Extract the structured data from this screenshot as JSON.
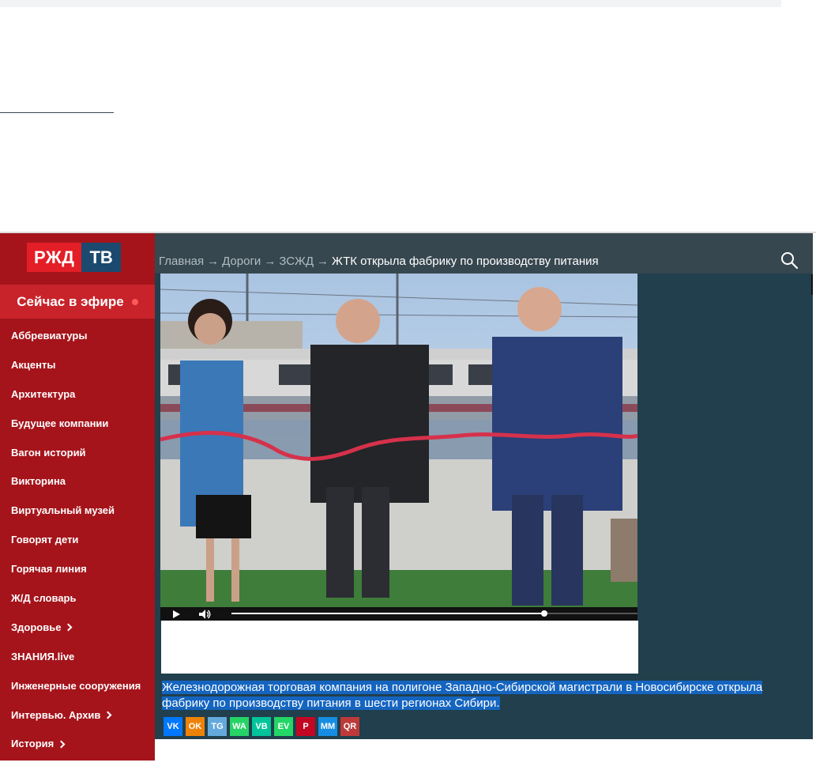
{
  "brand": {
    "logo_left": "РЖД",
    "logo_right": "ТВ"
  },
  "live_button": {
    "label": "Сейчас в эфире"
  },
  "sidebar": {
    "items": [
      {
        "label": "Аббревиатуры",
        "has_submenu": false
      },
      {
        "label": "Акценты",
        "has_submenu": false
      },
      {
        "label": "Архитектура",
        "has_submenu": false
      },
      {
        "label": "Будущее компании",
        "has_submenu": false
      },
      {
        "label": "Вагон историй",
        "has_submenu": false
      },
      {
        "label": "Викторина",
        "has_submenu": false
      },
      {
        "label": "Виртуальный музей",
        "has_submenu": false
      },
      {
        "label": "Говорят дети",
        "has_submenu": false
      },
      {
        "label": "Горячая линия",
        "has_submenu": false
      },
      {
        "label": "Ж/Д словарь",
        "has_submenu": false
      },
      {
        "label": "Здоровье",
        "has_submenu": true
      },
      {
        "label": "ЗНАНИЯ.live",
        "has_submenu": false
      },
      {
        "label": "Инженерные сооружения",
        "has_submenu": false
      },
      {
        "label": "Интервью. Архив",
        "has_submenu": true
      },
      {
        "label": "История",
        "has_submenu": true
      }
    ]
  },
  "breadcrumb": {
    "items": [
      "Главная",
      "Дороги",
      "ЗСЖД"
    ],
    "separator": "→",
    "current": "ЖТК открыла фабрику по производству питания"
  },
  "video": {
    "progress": 0.77
  },
  "article": {
    "lead": "Железнодорожная торговая компания на полигоне Западно-Сибирской магистрали в Новосибирске открыла фабрику по производству питания в шести регионах Сибири."
  },
  "share": [
    {
      "name": "vk",
      "label": "VK",
      "color": "#0077ff"
    },
    {
      "name": "odnoklassniki",
      "label": "OK",
      "color": "#ee8208"
    },
    {
      "name": "telegram",
      "label": "TG",
      "color": "#64a9dc"
    },
    {
      "name": "whatsapp",
      "label": "WA",
      "color": "#25d366"
    },
    {
      "name": "viber",
      "label": "VB",
      "color": "#00c49a"
    },
    {
      "name": "evernote",
      "label": "EV",
      "color": "#24d666"
    },
    {
      "name": "pinterest",
      "label": "P",
      "color": "#c20724"
    },
    {
      "name": "moimir",
      "label": "MM",
      "color": "#168de2"
    },
    {
      "name": "qrcode",
      "label": "QR",
      "color": "#be3a3a"
    }
  ]
}
